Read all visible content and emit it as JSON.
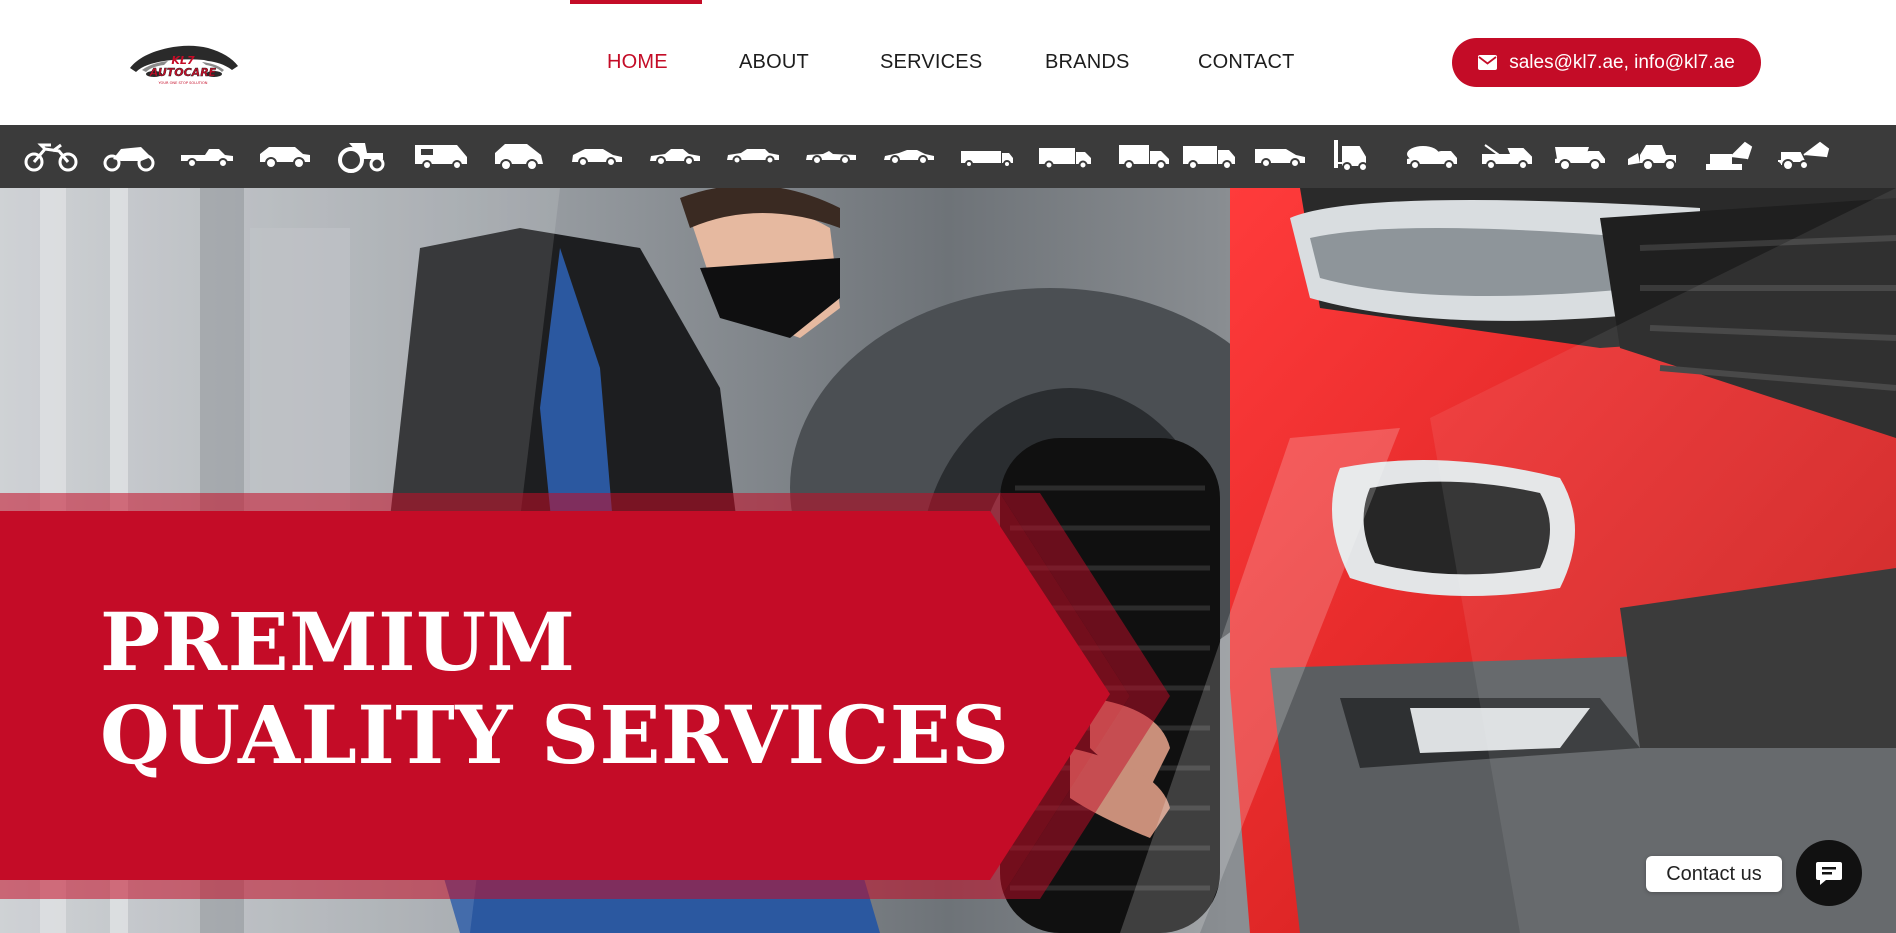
{
  "brand": {
    "logo_line1": "KL7",
    "logo_line2": "AUTOCARE",
    "logo_tagline": "YOUR ONE STOP SOLUTION"
  },
  "nav": {
    "items": [
      {
        "label": "HOME",
        "active": true
      },
      {
        "label": "ABOUT",
        "active": false
      },
      {
        "label": "SERVICES",
        "active": false
      },
      {
        "label": "BRANDS",
        "active": false
      },
      {
        "label": "CONTACT",
        "active": false
      }
    ]
  },
  "contact_button": {
    "label": "sales@kl7.ae, info@kl7.ae",
    "icon": "envelope-icon"
  },
  "vehicle_icons": [
    "dirt-bike-icon",
    "sport-bike-icon",
    "pickup-truck-icon",
    "suv-icon",
    "tractor-icon",
    "camper-van-icon",
    "hatchback-icon",
    "compact-car-icon",
    "sedan-icon",
    "limousine-icon",
    "convertible-icon",
    "coupe-icon",
    "long-truck-icon",
    "box-truck-icon",
    "delivery-truck-icon",
    "cargo-truck-icon",
    "van-icon",
    "forklift-icon",
    "cement-mixer-icon",
    "tow-truck-icon",
    "dump-truck-icon",
    "wheel-loader-icon",
    "excavator-icon",
    "backhoe-icon"
  ],
  "hero": {
    "title_line1": "PREMIUM",
    "title_line2": "QUALITY SERVICES"
  },
  "chat_widget": {
    "label": "Contact us",
    "icon": "chat-icon"
  },
  "colors": {
    "accent": "#c40c27",
    "vehicle_bar": "#3b3b3b",
    "text": "#1d1d1d"
  }
}
